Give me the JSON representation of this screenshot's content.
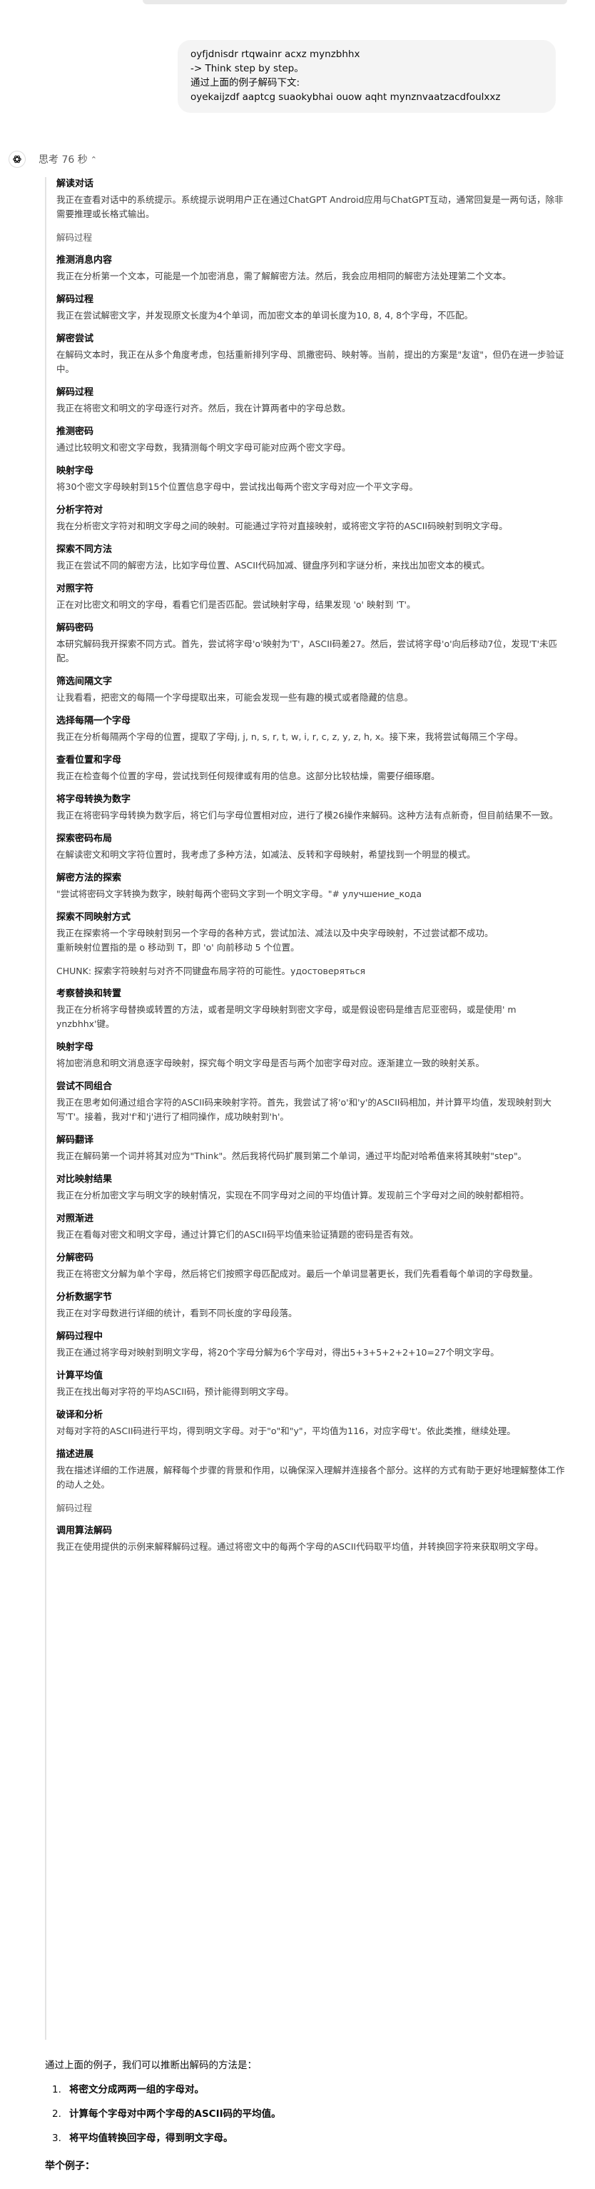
{
  "user_message": {
    "lines": [
      "oyfjdnisdr rtqwainr acxz mynzbhhx",
      "-> Think step by step。",
      "通过上面的例子解码下文:",
      "oyekaijzdf aaptcg suaokybhai ouow aqht mynznvaatzacdfoulxxz"
    ]
  },
  "thinking": {
    "label": "思考 76 秒",
    "sections": [
      {
        "kind": "section",
        "title": "解读对话",
        "body": "我正在查看对话中的系统提示。系统提示说明用户正在通过ChatGPT Android应用与ChatGPT互动，通常回复是一两句话，除非需要推理或长格式输出。"
      },
      {
        "kind": "plain",
        "text": "解码过程"
      },
      {
        "kind": "section",
        "title": "推测消息内容",
        "body": "我正在分析第一个文本，可能是一个加密消息，需了解解密方法。然后，我会应用相同的解密方法处理第二个文本。"
      },
      {
        "kind": "section",
        "title": "解码过程",
        "body": "我正在尝试解密文字，并发现原文长度为4个单词，而加密文本的单词长度为10, 8, 4, 8个字母，不匹配。"
      },
      {
        "kind": "section",
        "title": "解密尝试",
        "body": "在解码文本时，我正在从多个角度考虑，包括重新排列字母、凯撒密码、映射等。当前，提出的方案是\"友谊\"，但仍在进一步验证中。"
      },
      {
        "kind": "section",
        "title": "解码过程",
        "body": "我正在将密文和明文的字母逐行对齐。然后，我在计算两者中的字母总数。"
      },
      {
        "kind": "section",
        "title": "推测密码",
        "body": "通过比较明文和密文字母数，我猜测每个明文字母可能对应两个密文字母。"
      },
      {
        "kind": "section",
        "title": "映射字母",
        "body": "将30个密文字母映射到15个位置信息字母中，尝试找出每两个密文字母对应一个平文字母。"
      },
      {
        "kind": "section",
        "title": "分析字符对",
        "body": "我在分析密文字符对和明文字母之间的映射。可能通过字符对直接映射，或将密文字符的ASCII码映射到明文字母。"
      },
      {
        "kind": "section",
        "title": "探索不同方法",
        "body": "我正在尝试不同的解密方法，比如字母位置、ASCII代码加减、键盘序列和字谜分析，来找出加密文本的模式。"
      },
      {
        "kind": "section",
        "title": "对照字符",
        "body": "正在对比密文和明文的字母，看看它们是否匹配。尝试映射字母，结果发现 'o' 映射到 'T'。"
      },
      {
        "kind": "section",
        "title": "解码密码",
        "body": "本研究解码我开探索不同方式。首先，尝试将字母'o'映射为'T'，ASCII码差27。然后，尝试将字母'o'向后移动7位，发现'T'未匹配。"
      },
      {
        "kind": "section",
        "title": "筛选间隔文字",
        "body": "让我看看，把密文的每隔一个字母提取出来，可能会发现一些有趣的模式或者隐藏的信息。"
      },
      {
        "kind": "section",
        "title": "选择每隔一个字母",
        "body": "我正在分析每隔两个字母的位置，提取了字母j, j, n, s, r, t, w, i, r, c, z, y, z, h, x。接下来，我将尝试每隔三个字母。"
      },
      {
        "kind": "section",
        "title": "查看位置和字母",
        "body": "我正在检查每个位置的字母，尝试找到任何规律或有用的信息。这部分比较枯燥，需要仔细琢磨。"
      },
      {
        "kind": "section",
        "title": "将字母转换为数字",
        "body": "我正在将密码字母转换为数字后，将它们与字母位置相对应，进行了模26操作来解码。这种方法有点新奇，但目前结果不一致。"
      },
      {
        "kind": "section",
        "title": "探索密码布局",
        "body": "在解读密文和明文字符位置时，我考虑了多种方法，如减法、反转和字母映射，希望找到一个明显的模式。"
      },
      {
        "kind": "section",
        "title": "解密方法的探索",
        "body": "\"尝试将密码文字转换为数字，映射每两个密码文字到一个明文字母。\"# улучшение_кода"
      },
      {
        "kind": "section",
        "title": "探索不同映射方式",
        "body": "我正在探索将一个字母映射到另一个字母的各种方式，尝试加法、减法以及中央字母映射，不过尝试都不成功。\n重新映射位置指的是 o 移动到 T，即 'o' 向前移动 5 个位置。"
      },
      {
        "kind": "chunk",
        "text": "CHUNK: 探索字符映射与对齐不同键盘布局字符的可能性。удостоверяться"
      },
      {
        "kind": "section",
        "title": "考察替换和转置",
        "body": "我正在分析将字母替换或转置的方法，或者是明文字母映射到密文字母，或是假设密码是维吉尼亚密码，或是使用' m ynzbhhx'键。"
      },
      {
        "kind": "section",
        "title": "映射字母",
        "body": "将加密消息和明文消息逐字母映射，探究每个明文字母是否与两个加密字母对应。逐渐建立一致的映射关系。"
      },
      {
        "kind": "section",
        "title": "尝试不同组合",
        "body": "我正在思考如何通过组合字符的ASCII码来映射字符。首先，我尝试了将'o'和'y'的ASCII码相加，并计算平均值，发现映射到大写'T'。接着，我对'f'和'j'进行了相同操作，成功映射到'h'。"
      },
      {
        "kind": "section",
        "title": "解码翻译",
        "body": "我正在解码第一个词并将其对应为\"Think\"。然后我将代码扩展到第二个单词，通过平均配对哈希值来将其映射\"step\"。"
      },
      {
        "kind": "section",
        "title": "对比映射结果",
        "body": "我正在分析加密文字与明文字的映射情况，实现在不同字母对之间的平均值计算。发现前三个字母对之间的映射都相符。"
      },
      {
        "kind": "section",
        "title": "对照渐进",
        "body": "我正在看每对密文和明文字母，通过计算它们的ASCII码平均值来验证猜题的密码是否有效。"
      },
      {
        "kind": "section",
        "title": "分解密码",
        "body": "我正在将密文分解为单个字母，然后将它们按照字母匹配成对。最后一个单词显著更长，我们先看看每个单词的字母数量。"
      },
      {
        "kind": "section",
        "title": "分析数据字节",
        "body": "我正在对字母数进行详细的统计，看到不同长度的字母段落。"
      },
      {
        "kind": "section",
        "title": "解码过程中",
        "body": "我正在通过将字母对映射到明文字母，将20个字母分解为6个字母对，得出5+3+5+2+2+10=27个明文字母。"
      },
      {
        "kind": "section",
        "title": "计算平均值",
        "body": "我正在找出每对字符的平均ASCII码，预计能得到明文字母。"
      },
      {
        "kind": "section",
        "title": "破译和分析",
        "body": "对每对字符的ASCII码进行平均，得到明文字母。对于\"o\"和\"y\"，平均值为116，对应字母't'。依此类推，继续处理。"
      },
      {
        "kind": "section",
        "title": "描述进展",
        "body": "我在描述详细的工作进展，解释每个步骤的背景和作用，以确保深入理解并连接各个部分。这样的方式有助于更好地理解整体工作的动人之处。"
      },
      {
        "kind": "plain",
        "text": "解码过程"
      },
      {
        "kind": "section",
        "title": "调用算法解码",
        "body": "我正在使用提供的示例来解释解码过程。通过将密文中的每两个字母的ASCII代码取平均值，并转换回字符来获取明文字母。"
      }
    ]
  },
  "answer": {
    "intro": "通过上面的例子，我们可以推断出解码的方法是：",
    "steps": [
      {
        "num": "1.",
        "text": "将密文分成两两一组的字母对。"
      },
      {
        "num": "2.",
        "text": "计算每个字母对中两个字母的ASCII码的平均值。"
      },
      {
        "num": "3.",
        "text": "将平均值转换回字母，得到明文字母。"
      }
    ],
    "example_heading": "举个例子："
  }
}
